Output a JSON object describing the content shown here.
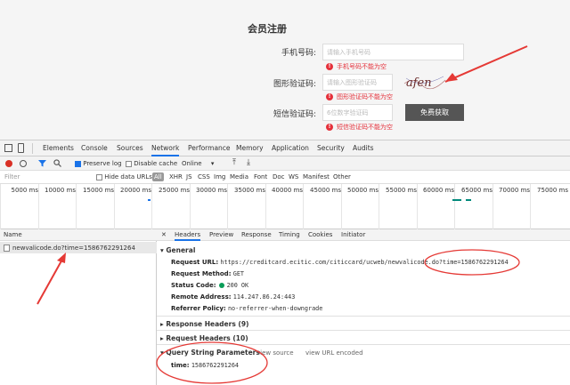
{
  "form": {
    "title": "会员注册",
    "phone": {
      "label": "手机号码:",
      "placeholder": "请输入手机号码",
      "error": "手机号码不能为空"
    },
    "captcha": {
      "label": "图形验证码:",
      "placeholder": "请输入图形验证码",
      "error": "图形验证码不能为空",
      "image_text": "afen"
    },
    "sms": {
      "label": "短信验证码:",
      "placeholder": "6位数字验证码",
      "button": "免费获取",
      "error": "短信验证码不能为空"
    }
  },
  "devtools": {
    "tabs": [
      "Elements",
      "Console",
      "Sources",
      "Network",
      "Performance",
      "Memory",
      "Application",
      "Security",
      "Audits"
    ],
    "active_tab": "Network",
    "toolbar": {
      "preserve_log": "Preserve log",
      "disable_cache": "Disable cache",
      "throttle": "Online"
    },
    "filter": {
      "placeholder": "Filter",
      "hide_data_urls": "Hide data URLs",
      "types": [
        "All",
        "XHR",
        "JS",
        "CSS",
        "Img",
        "Media",
        "Font",
        "Doc",
        "WS",
        "Manifest",
        "Other"
      ]
    },
    "timeline_ticks": [
      "5000 ms",
      "10000 ms",
      "15000 ms",
      "20000 ms",
      "25000 ms",
      "30000 ms",
      "35000 ms",
      "40000 ms",
      "45000 ms",
      "50000 ms",
      "55000 ms",
      "60000 ms",
      "65000 ms",
      "70000 ms",
      "75000 ms"
    ],
    "name_header": "Name",
    "request_name": "newvalicode.do?time=1586762291264",
    "detail_tabs": [
      "Headers",
      "Preview",
      "Response",
      "Timing",
      "Cookies",
      "Initiator"
    ],
    "general": {
      "title": "General",
      "request_url_label": "Request URL:",
      "request_url": "https://creditcard.ecitic.com/citiccard/ucweb/newvalicode.do?time=1586762291264",
      "method_label": "Request Method:",
      "method": "GET",
      "status_label": "Status Code:",
      "status": "200 OK",
      "remote_label": "Remote Address:",
      "remote": "114.247.86.24:443",
      "referrer_label": "Referrer Policy:",
      "referrer": "no-referrer-when-downgrade"
    },
    "response_headers": "Response Headers (9)",
    "request_headers": "Request Headers (10)",
    "query": {
      "title": "Query String Parameters",
      "view_source": "view source",
      "view_encoded": "view URL encoded",
      "param_key": "time:",
      "param_value": "1586762291264"
    }
  },
  "colors": {
    "error": "#e5303a",
    "annotation": "#e53935",
    "accent": "#1a73e8"
  }
}
